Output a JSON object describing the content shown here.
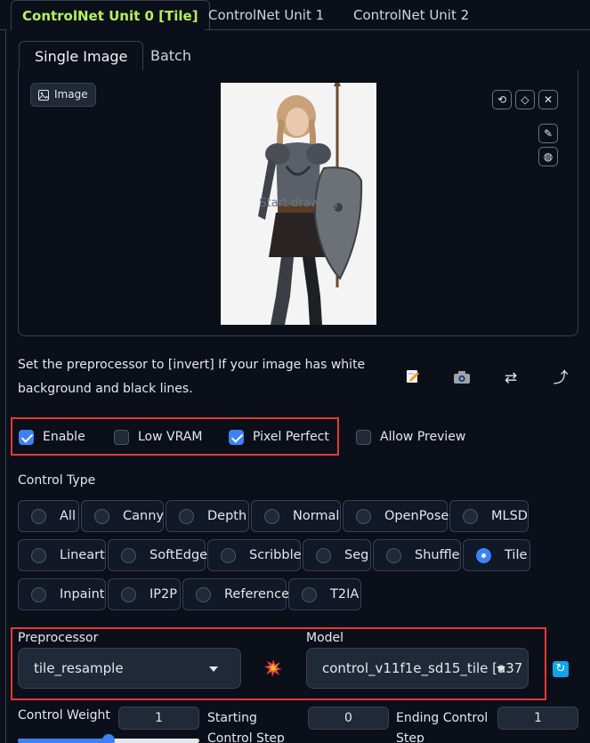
{
  "unit_tabs": [
    "ControlNet Unit 0 [Tile]",
    "ControlNet Unit 1",
    "ControlNet Unit 2"
  ],
  "image_tabs": [
    "Single Image",
    "Batch"
  ],
  "image_panel": {
    "label": "Image",
    "canvas_hint": "Start drawing"
  },
  "description": "Set the preprocessor to [invert] If your image has white background and black lines.",
  "checkboxes": {
    "enable": {
      "label": "Enable",
      "checked": true
    },
    "low_vram": {
      "label": "Low VRAM",
      "checked": false
    },
    "pixel_perfect": {
      "label": "Pixel Perfect",
      "checked": true
    },
    "allow_preview": {
      "label": "Allow Preview",
      "checked": false
    }
  },
  "control_type": {
    "label": "Control Type",
    "options": [
      "All",
      "Canny",
      "Depth",
      "Normal",
      "OpenPose",
      "MLSD",
      "Lineart",
      "SoftEdge",
      "Scribble",
      "Seg",
      "Shuffle",
      "Tile",
      "Inpaint",
      "IP2P",
      "Reference",
      "T2IA"
    ],
    "selected": "Tile"
  },
  "preprocessor": {
    "label": "Preprocessor",
    "value": "tile_resample"
  },
  "model": {
    "label": "Model",
    "value": "control_v11f1e_sd15_tile [a37"
  },
  "control_weight": {
    "label": "Control Weight",
    "value": "1",
    "fraction": 0.5
  },
  "starting_step": {
    "label": "Starting Control Step",
    "value": "0"
  },
  "ending_step": {
    "label": "Ending Control Step",
    "value": "1"
  },
  "colors": {
    "accent": "#b5f15b",
    "primary": "#3b82f6",
    "highlight": "#e53935",
    "background": "#0b0f19"
  },
  "icons": [
    "image-icon",
    "undo-icon",
    "eraser-icon",
    "close-icon",
    "brush-icon",
    "palette-icon",
    "edit-icon",
    "camera-icon",
    "swap-icon",
    "send-dimensions-icon",
    "explosion-icon",
    "refresh-icon",
    "caret-down-icon"
  ]
}
